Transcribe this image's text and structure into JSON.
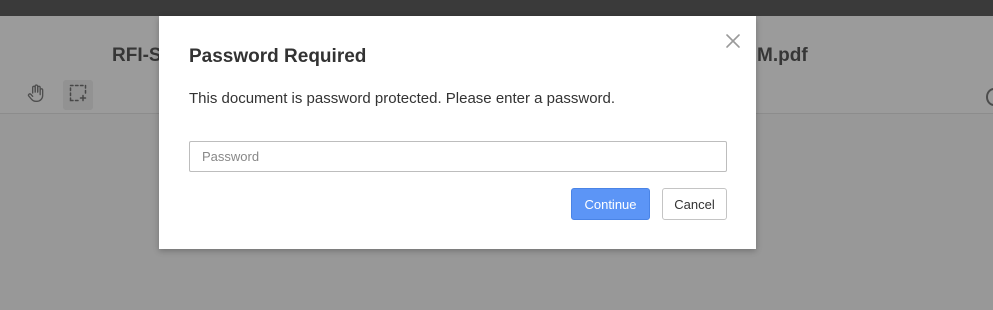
{
  "background_app": {
    "document_title_visible_left": "RFI-S",
    "document_title_visible_right": "M.pdf",
    "tools": [
      {
        "icon": "hand-pan-icon"
      },
      {
        "icon": "marquee-select-icon"
      }
    ]
  },
  "dialog": {
    "title": "Password Required",
    "message": "This document is password protected. Please enter a password.",
    "password_field": {
      "value": "",
      "placeholder": "Password"
    },
    "continue_label": "Continue",
    "cancel_label": "Cancel",
    "close_icon": "close-icon"
  },
  "colors": {
    "primary_button": "#5c95f6",
    "overlay": "rgba(0,0,0,0.36)"
  }
}
